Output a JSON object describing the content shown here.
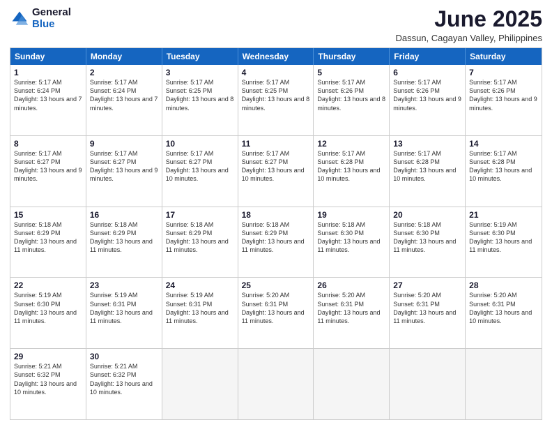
{
  "logo": {
    "general": "General",
    "blue": "Blue"
  },
  "title": "June 2025",
  "location": "Dassun, Cagayan Valley, Philippines",
  "header_days": [
    "Sunday",
    "Monday",
    "Tuesday",
    "Wednesday",
    "Thursday",
    "Friday",
    "Saturday"
  ],
  "weeks": [
    [
      {
        "day": "1",
        "sunrise": "Sunrise: 5:17 AM",
        "sunset": "Sunset: 6:24 PM",
        "daylight": "Daylight: 13 hours and 7 minutes."
      },
      {
        "day": "2",
        "sunrise": "Sunrise: 5:17 AM",
        "sunset": "Sunset: 6:24 PM",
        "daylight": "Daylight: 13 hours and 7 minutes."
      },
      {
        "day": "3",
        "sunrise": "Sunrise: 5:17 AM",
        "sunset": "Sunset: 6:25 PM",
        "daylight": "Daylight: 13 hours and 8 minutes."
      },
      {
        "day": "4",
        "sunrise": "Sunrise: 5:17 AM",
        "sunset": "Sunset: 6:25 PM",
        "daylight": "Daylight: 13 hours and 8 minutes."
      },
      {
        "day": "5",
        "sunrise": "Sunrise: 5:17 AM",
        "sunset": "Sunset: 6:26 PM",
        "daylight": "Daylight: 13 hours and 8 minutes."
      },
      {
        "day": "6",
        "sunrise": "Sunrise: 5:17 AM",
        "sunset": "Sunset: 6:26 PM",
        "daylight": "Daylight: 13 hours and 9 minutes."
      },
      {
        "day": "7",
        "sunrise": "Sunrise: 5:17 AM",
        "sunset": "Sunset: 6:26 PM",
        "daylight": "Daylight: 13 hours and 9 minutes."
      }
    ],
    [
      {
        "day": "8",
        "sunrise": "Sunrise: 5:17 AM",
        "sunset": "Sunset: 6:27 PM",
        "daylight": "Daylight: 13 hours and 9 minutes."
      },
      {
        "day": "9",
        "sunrise": "Sunrise: 5:17 AM",
        "sunset": "Sunset: 6:27 PM",
        "daylight": "Daylight: 13 hours and 9 minutes."
      },
      {
        "day": "10",
        "sunrise": "Sunrise: 5:17 AM",
        "sunset": "Sunset: 6:27 PM",
        "daylight": "Daylight: 13 hours and 10 minutes."
      },
      {
        "day": "11",
        "sunrise": "Sunrise: 5:17 AM",
        "sunset": "Sunset: 6:27 PM",
        "daylight": "Daylight: 13 hours and 10 minutes."
      },
      {
        "day": "12",
        "sunrise": "Sunrise: 5:17 AM",
        "sunset": "Sunset: 6:28 PM",
        "daylight": "Daylight: 13 hours and 10 minutes."
      },
      {
        "day": "13",
        "sunrise": "Sunrise: 5:17 AM",
        "sunset": "Sunset: 6:28 PM",
        "daylight": "Daylight: 13 hours and 10 minutes."
      },
      {
        "day": "14",
        "sunrise": "Sunrise: 5:17 AM",
        "sunset": "Sunset: 6:28 PM",
        "daylight": "Daylight: 13 hours and 10 minutes."
      }
    ],
    [
      {
        "day": "15",
        "sunrise": "Sunrise: 5:18 AM",
        "sunset": "Sunset: 6:29 PM",
        "daylight": "Daylight: 13 hours and 11 minutes."
      },
      {
        "day": "16",
        "sunrise": "Sunrise: 5:18 AM",
        "sunset": "Sunset: 6:29 PM",
        "daylight": "Daylight: 13 hours and 11 minutes."
      },
      {
        "day": "17",
        "sunrise": "Sunrise: 5:18 AM",
        "sunset": "Sunset: 6:29 PM",
        "daylight": "Daylight: 13 hours and 11 minutes."
      },
      {
        "day": "18",
        "sunrise": "Sunrise: 5:18 AM",
        "sunset": "Sunset: 6:29 PM",
        "daylight": "Daylight: 13 hours and 11 minutes."
      },
      {
        "day": "19",
        "sunrise": "Sunrise: 5:18 AM",
        "sunset": "Sunset: 6:30 PM",
        "daylight": "Daylight: 13 hours and 11 minutes."
      },
      {
        "day": "20",
        "sunrise": "Sunrise: 5:18 AM",
        "sunset": "Sunset: 6:30 PM",
        "daylight": "Daylight: 13 hours and 11 minutes."
      },
      {
        "day": "21",
        "sunrise": "Sunrise: 5:19 AM",
        "sunset": "Sunset: 6:30 PM",
        "daylight": "Daylight: 13 hours and 11 minutes."
      }
    ],
    [
      {
        "day": "22",
        "sunrise": "Sunrise: 5:19 AM",
        "sunset": "Sunset: 6:30 PM",
        "daylight": "Daylight: 13 hours and 11 minutes."
      },
      {
        "day": "23",
        "sunrise": "Sunrise: 5:19 AM",
        "sunset": "Sunset: 6:31 PM",
        "daylight": "Daylight: 13 hours and 11 minutes."
      },
      {
        "day": "24",
        "sunrise": "Sunrise: 5:19 AM",
        "sunset": "Sunset: 6:31 PM",
        "daylight": "Daylight: 13 hours and 11 minutes."
      },
      {
        "day": "25",
        "sunrise": "Sunrise: 5:20 AM",
        "sunset": "Sunset: 6:31 PM",
        "daylight": "Daylight: 13 hours and 11 minutes."
      },
      {
        "day": "26",
        "sunrise": "Sunrise: 5:20 AM",
        "sunset": "Sunset: 6:31 PM",
        "daylight": "Daylight: 13 hours and 11 minutes."
      },
      {
        "day": "27",
        "sunrise": "Sunrise: 5:20 AM",
        "sunset": "Sunset: 6:31 PM",
        "daylight": "Daylight: 13 hours and 11 minutes."
      },
      {
        "day": "28",
        "sunrise": "Sunrise: 5:20 AM",
        "sunset": "Sunset: 6:31 PM",
        "daylight": "Daylight: 13 hours and 10 minutes."
      }
    ],
    [
      {
        "day": "29",
        "sunrise": "Sunrise: 5:21 AM",
        "sunset": "Sunset: 6:32 PM",
        "daylight": "Daylight: 13 hours and 10 minutes."
      },
      {
        "day": "30",
        "sunrise": "Sunrise: 5:21 AM",
        "sunset": "Sunset: 6:32 PM",
        "daylight": "Daylight: 13 hours and 10 minutes."
      },
      {
        "day": "",
        "sunrise": "",
        "sunset": "",
        "daylight": ""
      },
      {
        "day": "",
        "sunrise": "",
        "sunset": "",
        "daylight": ""
      },
      {
        "day": "",
        "sunrise": "",
        "sunset": "",
        "daylight": ""
      },
      {
        "day": "",
        "sunrise": "",
        "sunset": "",
        "daylight": ""
      },
      {
        "day": "",
        "sunrise": "",
        "sunset": "",
        "daylight": ""
      }
    ]
  ]
}
